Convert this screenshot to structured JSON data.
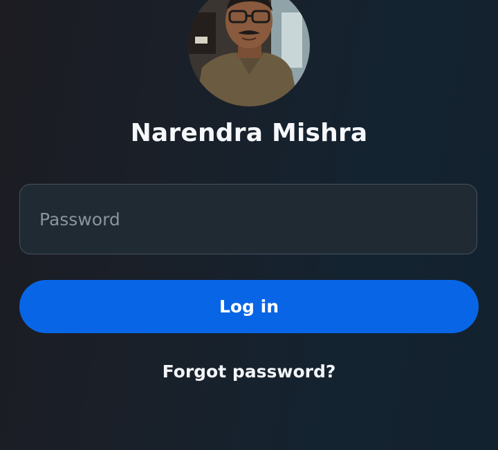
{
  "profile": {
    "name": "Narendra Mishra",
    "avatar_icon": "profile-photo"
  },
  "login_form": {
    "password_placeholder": "Password",
    "password_value": "",
    "login_label": "Log in",
    "forgot_password_label": "Forgot password?"
  },
  "colors": {
    "background": "#172330",
    "primary_button": "#0866e6",
    "input_background": "#1f2a33",
    "input_border": "#46525e",
    "placeholder_text": "#8a949d"
  }
}
